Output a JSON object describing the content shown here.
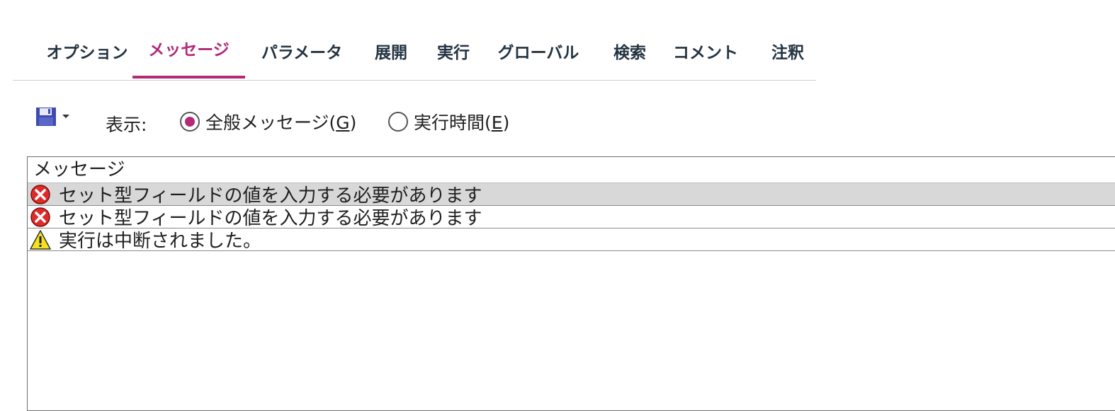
{
  "tabs": [
    {
      "label": "オプション",
      "active": false
    },
    {
      "label": "メッセージ",
      "active": true
    },
    {
      "label": "パラメータ",
      "active": false
    },
    {
      "label": "展開",
      "active": false
    },
    {
      "label": "実行",
      "active": false
    },
    {
      "label": "グローバル",
      "active": false
    },
    {
      "label": "検索",
      "active": false
    },
    {
      "label": "コメント",
      "active": false
    },
    {
      "label": "注釈",
      "active": false
    }
  ],
  "toolbar": {
    "save_icon": "save-icon",
    "show_label": "表示:",
    "radio_general_label": "全般メッセージ(",
    "radio_general_key": "G",
    "radio_exec_label": "実行時間(",
    "radio_exec_key": "E",
    "radio_close": ")",
    "selected": "general"
  },
  "messages": {
    "header": "メッセージ",
    "rows": [
      {
        "icon": "error-icon",
        "text": "セット型フィールドの値を入力する必要があります",
        "selected": true
      },
      {
        "icon": "error-icon",
        "text": "セット型フィールドの値を入力する必要があります",
        "selected": false
      },
      {
        "icon": "warning-icon",
        "text": "実行は中断されました。",
        "selected": false
      }
    ]
  },
  "colors": {
    "accent": "#b32a78",
    "tab_text": "#243442",
    "error": "#e02a2a",
    "warning": "#f5e21a"
  }
}
